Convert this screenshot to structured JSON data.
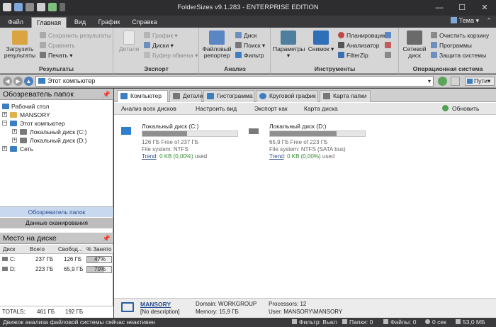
{
  "window": {
    "title": "FolderSizes v9.1.283 - ENTERPRISE EDITION",
    "minimize": "—",
    "maximize": "☐",
    "close": "✕"
  },
  "tabs": [
    {
      "label": "Файл"
    },
    {
      "label": "Главная"
    },
    {
      "label": "Вид"
    },
    {
      "label": "График"
    },
    {
      "label": "Справка"
    }
  ],
  "theme_label": "Тема",
  "ribbon": {
    "results": {
      "label": "Результаты",
      "load": "Загрузить результаты",
      "save": "Сохранить результаты",
      "compare": "Сравнить",
      "print": "Печать"
    },
    "export": {
      "label": "Экспорт",
      "details": "Детали",
      "chart": "График",
      "disks": "Диски",
      "clipboard": "Буфер обмена"
    },
    "analysis": {
      "label": "Анализ",
      "reporter": "Файловый репортер",
      "disk": "Диск",
      "search": "Поиск",
      "filter": "Фильтр"
    },
    "tools": {
      "label": "Инструменты",
      "params": "Параметры",
      "snapshot": "Снимок",
      "scheduler": "Планировщик",
      "analyzer": "Анализатор",
      "filezip": "FilterZip"
    },
    "os": {
      "label": "Операционная система",
      "netdisk": "Сетевой диск",
      "recycle": "Очистить корзину",
      "programs": "Программы",
      "protection": "Защита системы"
    }
  },
  "address": {
    "value": "Этот компьютер",
    "paths_label": "Пути"
  },
  "folder_explorer": {
    "title": "Обозреватель папок",
    "tree": [
      {
        "label": "Рабочий стол"
      },
      {
        "label": "MANSORY"
      },
      {
        "label": "Этот компьютер"
      },
      {
        "label": "Локальный диск (C:)"
      },
      {
        "label": "Локальный диск (D:)"
      },
      {
        "label": "Сеть"
      }
    ],
    "tab_explorer": "Обозреватель папок",
    "tab_scan": "Данные сканирования"
  },
  "disk_space": {
    "title": "Место на диске",
    "headers": [
      "Диск",
      "Всего",
      "Свобод...",
      "% Занято"
    ],
    "rows": [
      {
        "drive": "C:",
        "total": "237 ГБ",
        "free": "126 ГБ",
        "used_pct_label": "47%",
        "used_fraction": 0.47
      },
      {
        "drive": "D:",
        "total": "223 ГБ",
        "free": "65,9 ГБ",
        "used_pct_label": "70%",
        "used_fraction": 0.7
      }
    ],
    "totals": {
      "label": "TOTALS:",
      "total": "461 ГБ",
      "free": "192 ГБ"
    }
  },
  "view_tabs": [
    {
      "label": "Компьютер"
    },
    {
      "label": "Детали"
    },
    {
      "label": "Гистограмма"
    },
    {
      "label": "Круговой график"
    },
    {
      "label": "Карта папки"
    }
  ],
  "commands": {
    "analyze_all": "Анализ всех дисков",
    "customize": "Настроить вид",
    "export_as": "Экспорт как",
    "disk_map": "Карта диска",
    "refresh": "Обновить"
  },
  "drives": [
    {
      "name": "Локальный диск (C:)",
      "free_line": "126 ГБ Free of 237 ГБ",
      "fs_line": "File system: NTFS",
      "trend": "Trend",
      "trend_value": "0 KB (0,00%)",
      "trend_suffix": "used",
      "used_fraction": 0.47
    },
    {
      "name": "Локальный диск (D:)",
      "free_line": "65,9 ГБ Free of 223 ГБ",
      "fs_line": "File system: NTFS (SATA bus)",
      "trend": "Trend",
      "trend_value": "0 KB (0,00%)",
      "trend_suffix": "used",
      "used_fraction": 0.7
    }
  ],
  "computer": {
    "name": "MANSORY",
    "description": "[No description]",
    "domain": "Domain: WORKGROUP",
    "memory": "Memory: 15,9 ГБ",
    "processors": "Processors: 12",
    "user": "User: MANSORY\\MANSORY"
  },
  "status": {
    "message": "Движок анализа файловой системы сейчас неактивен",
    "filter": "Фильтр: Выкл",
    "folders": "Папки: 0",
    "files": "Файлы: 0",
    "time": "0 сек",
    "memory": "53,0 МБ"
  },
  "colors": {
    "accent": "#1f6fb5",
    "titlebar": "#2d2d30",
    "ribbon": "#d6d6d6",
    "link": "#2a4f8f",
    "trend_green": "#2e8b2e"
  }
}
